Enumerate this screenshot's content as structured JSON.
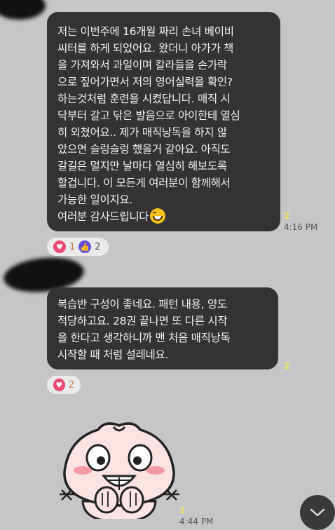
{
  "messages": [
    {
      "lines": [
        "저는 이번주에 16개월 짜리 손녀 베이비",
        "씨터를 하게 되었어요. 왔더니 아가가 책",
        "을 가져와서 과일이며 칼라들을 손가락",
        "으로 짚어가면서 저의 영어실력을 확인?",
        "하는것처럼 훈련을 시켰답니다. 매직 시",
        "닥부터 갈고 닦은 발음으로 아이한테 열심",
        "히 외쳤어요.. 제가 매직낭독을 하지 않",
        "았으면 슬렁슬렁 했을거 같아요. 아직도",
        "갈길은 멀지만 날마다 열심히 해보도록",
        "할겁니다. 이 모든게 여러분이 함께해서",
        "가능한 일이지요."
      ],
      "last_line": "여러분 감사드립니다",
      "emoji": "grinning-face-emoji",
      "unread": "2",
      "time": "4:16 PM",
      "reactions": {
        "heart": "1",
        "like": "2"
      }
    },
    {
      "lines": [
        "복습반 구성이 좋네요. 패턴 내용, 양도",
        "적당하고요. 28권 끝나면 또 다른 시작",
        "을 한다고 생각하니까 맨 처음 매직낭독",
        "시작할 때 처럼 설레네요."
      ],
      "unread": "2",
      "reactions": {
        "heart": "2"
      }
    }
  ],
  "sticker": {
    "name": "apeach-sticker",
    "unread": "2",
    "time": "4:44 PM"
  },
  "icons": {
    "heart": "heart-icon",
    "like": "thumbs-up-icon",
    "scroll": "chevron-down-icon"
  },
  "colors": {
    "bubble": "#333335",
    "background": "#c6c6c8",
    "unread": "#f0e25a",
    "heart": "#e94b72",
    "like": "#6a4de0"
  }
}
